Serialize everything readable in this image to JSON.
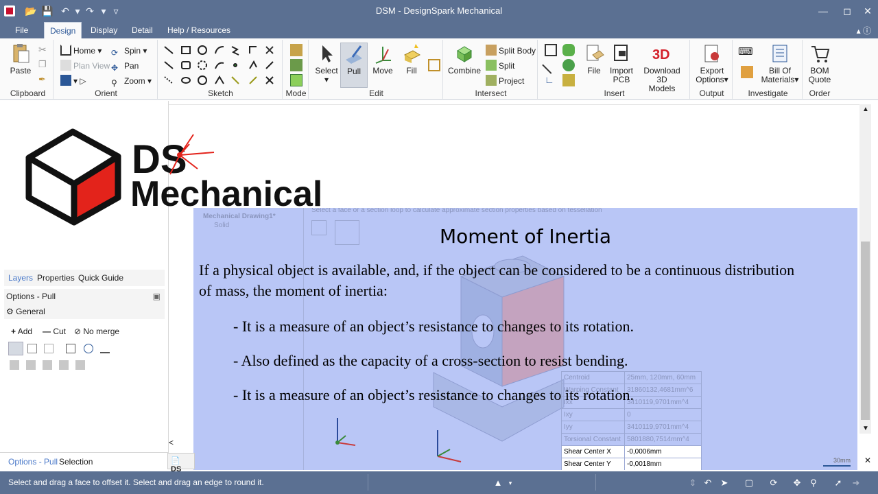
{
  "window": {
    "title": "DSM - DesignSpark Mechanical",
    "qat_icons": [
      "app-icon",
      "open-icon",
      "save-icon",
      "undo-icon",
      "redo-icon",
      "customize-icon"
    ]
  },
  "menu": {
    "tabs": [
      "File",
      "Design",
      "Display",
      "Detail",
      "Help / Resources"
    ],
    "active": "Design"
  },
  "ribbon": {
    "clipboard": {
      "label": "Clipboard",
      "paste": "Paste"
    },
    "orient": {
      "label": "Orient",
      "home": "Home",
      "plan_view": "Plan View",
      "spin": "Spin",
      "pan": "Pan",
      "zoom": "Zoom"
    },
    "sketch": {
      "label": "Sketch"
    },
    "mode": {
      "label": "Mode"
    },
    "edit": {
      "label": "Edit",
      "select": "Select",
      "pull": "Pull",
      "move": "Move",
      "fill": "Fill"
    },
    "intersect": {
      "label": "Intersect",
      "combine": "Combine",
      "split_body": "Split Body",
      "split": "Split",
      "project": "Project"
    },
    "insert": {
      "label": "Insert",
      "file": "File",
      "import_pcb_1": "Import",
      "import_pcb_2": "PCB",
      "download_1": "Download 3D",
      "download_2": "Models"
    },
    "output": {
      "label": "Output",
      "export_1": "Export",
      "export_2": "Options"
    },
    "investigate": {
      "label": "Investigate",
      "bom_1": "Bill Of",
      "bom_2": "Materials"
    },
    "order": {
      "label": "Order",
      "quote_1": "BOM",
      "quote_2": "Quote"
    }
  },
  "left_panel": {
    "tabs": [
      "Layers",
      "Properties",
      "Quick Guide"
    ],
    "active_tab": "Layers",
    "options_title": "Options - Pull",
    "general": "General",
    "add": "Add",
    "cut": "Cut",
    "no_merge": "No merge",
    "bottom_tabs": [
      "Options - Pull",
      "Selection"
    ]
  },
  "logo": {
    "line1": "DS",
    "line2": "Mechanical"
  },
  "slide": {
    "title": "Moment of Inertia",
    "para1_line1": "If a physical object is available, and, if the object can be considered to be a continuous distribution",
    "para1_line2": "of mass, the moment of inertia:",
    "bullet1": "- It is a measure of an object’s resistance to changes to its rotation.",
    "bullet2": "- Also defined as the capacity of a cross-section to resist bending.",
    "bullet3": "- It is a measure of an object’s resistance to changes to its rotation.",
    "ghost_header": "Select a face or a section loop to calculate approximate section properties based on tessellation",
    "ghost_tree": "Mechanical Drawing1*",
    "ghost_solid": "Solid",
    "properties": [
      {
        "k": "Centroid",
        "v": "25mm, 120mm, 60mm"
      },
      {
        "k": "Warping Constant",
        "v": "31860132,4681mm^6"
      },
      {
        "k": "Ixx",
        "v": "3410119,9701mm^4"
      },
      {
        "k": "Ixy",
        "v": "0"
      },
      {
        "k": "Iyy",
        "v": "3410119,9701mm^4"
      },
      {
        "k": "Torsional Constant",
        "v": "5801880,7514mm^4"
      },
      {
        "k": "Shear Center X",
        "v": "-0,0006mm"
      },
      {
        "k": "Shear Center Y",
        "v": "-0,0018mm"
      }
    ],
    "scale": "30mm"
  },
  "status": {
    "message": "Select and drag a face to offset it. Select and drag an edge to round it."
  },
  "colors": {
    "chrome": "#5b7092",
    "slide": "#b9c6f6",
    "brand_red": "#c8102e"
  }
}
